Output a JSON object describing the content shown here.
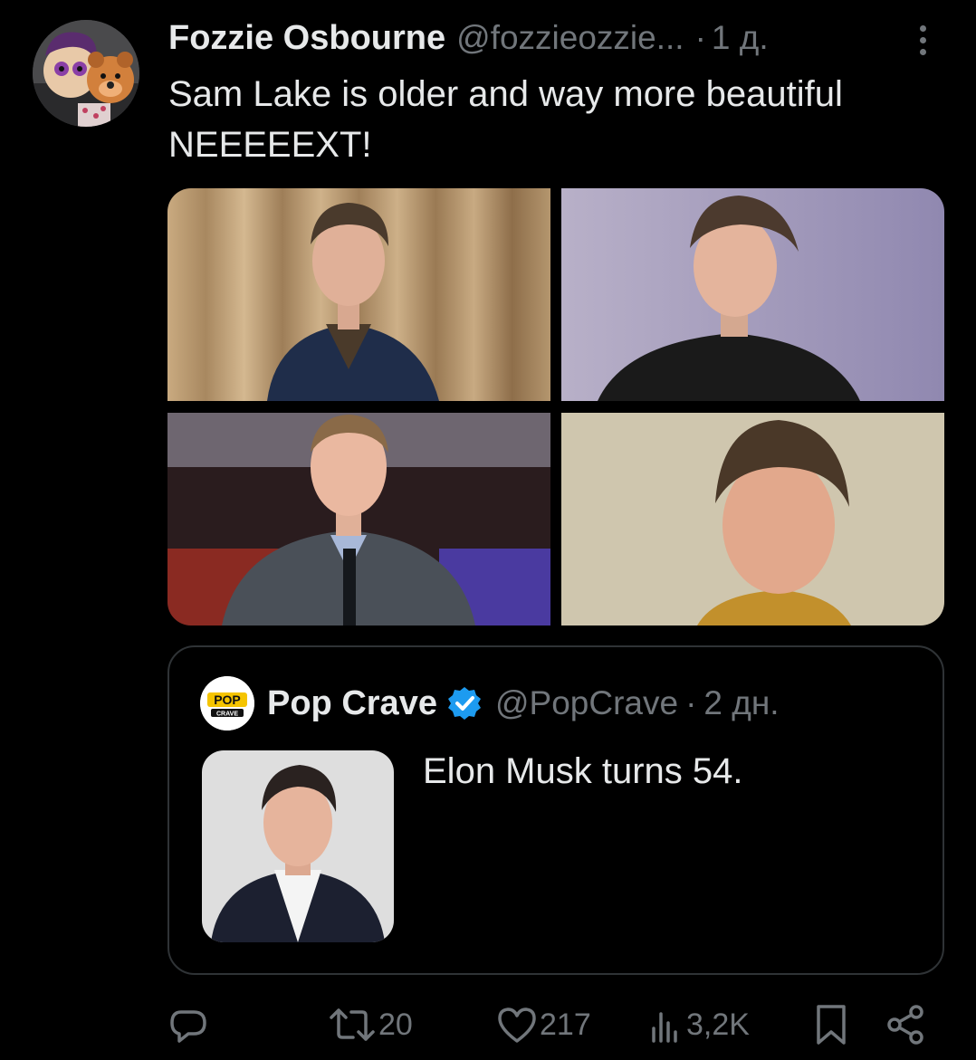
{
  "post": {
    "author": {
      "display_name": "Fozzie Osbourne",
      "handle": "@fozzieozzie...",
      "avatar_icon": "cartoon-bear-avatar"
    },
    "separator": "·",
    "timestamp": "1 д.",
    "text_lines": [
      "Sam Lake is older and way more beautiful",
      "NEEEEEXT!"
    ],
    "media_count": 4
  },
  "quoted_post": {
    "author": {
      "display_name": "Pop Crave",
      "handle": "@PopCrave",
      "verified": true,
      "avatar_text_top": "POP",
      "avatar_text_bottom": "CRAVE"
    },
    "separator": "·",
    "timestamp": "2 дн.",
    "text": "Elon Musk turns 54."
  },
  "actions": {
    "reply": {
      "icon": "reply-icon",
      "count": ""
    },
    "repost": {
      "icon": "repost-icon",
      "count": "20"
    },
    "like": {
      "icon": "heart-icon",
      "count": "217"
    },
    "views": {
      "icon": "views-icon",
      "count": "3,2K"
    },
    "bookmark": {
      "icon": "bookmark-icon"
    },
    "share": {
      "icon": "share-icon"
    }
  },
  "colors": {
    "background": "#000000",
    "text_primary": "#e7e9ea",
    "text_secondary": "#71767b",
    "border": "#2f3336",
    "verified": "#1d9bf0"
  }
}
